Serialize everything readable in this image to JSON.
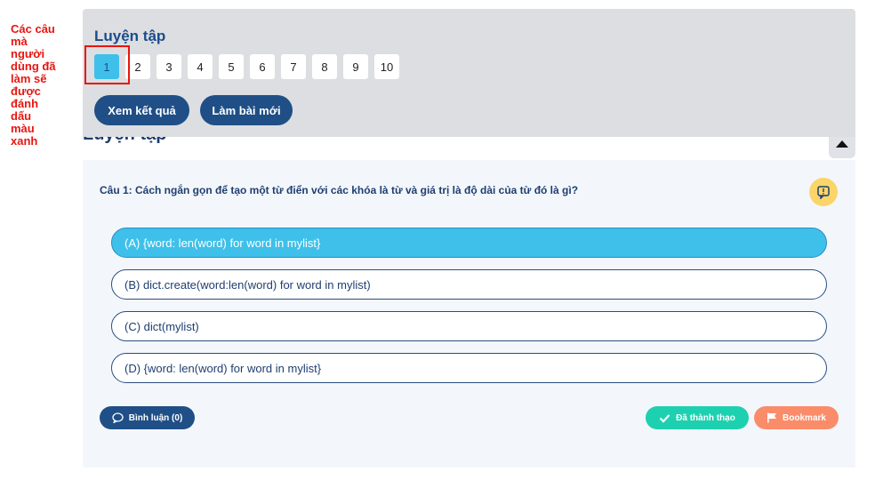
{
  "annotation": {
    "lines": [
      "Các câu",
      "mà",
      "người",
      "dùng đã",
      "làm sẽ",
      "được",
      "đánh",
      "dấu",
      "màu",
      "xanh"
    ]
  },
  "behind_header": {
    "title": "Luyện tập"
  },
  "practice": {
    "title": "Luyện tập",
    "question_numbers": [
      "1",
      "2",
      "3",
      "4",
      "5",
      "6",
      "7",
      "8",
      "9",
      "10"
    ],
    "done_color": "#3ec0ea",
    "view_results_label": "Xem kết quả",
    "new_attempt_label": "Làm bài mới"
  },
  "question": {
    "text": "Câu 1: Cách ngắn gọn để tạo một từ điển với các khóa là từ và giá trị là độ dài của từ đó là gì?",
    "options": [
      "(A) {word: len(word) for word in mylist}",
      "(B) dict.create(word:len(word) for word in mylist)",
      "(C) dict(mylist)",
      "(D) {word: len(word) for word in mylist}"
    ],
    "selected_option": "(A) {word: len(word) for word in mylist}",
    "comment_label": "Bình luận (0)",
    "mastered_label": "Đã thành thạo",
    "bookmark_label": "Bookmark"
  },
  "colors": {
    "primary": "#1f4f86",
    "selected": "#3ec0ea",
    "mastered": "#1dd1b0",
    "bookmark": "#fb8c6a",
    "annotation": "#e8150f"
  },
  "icons": {
    "scroll_top": "caret-up-icon",
    "report": "report-icon",
    "comment": "speech-bubble-icon",
    "mastered": "check-icon",
    "bookmark": "flag-icon"
  }
}
